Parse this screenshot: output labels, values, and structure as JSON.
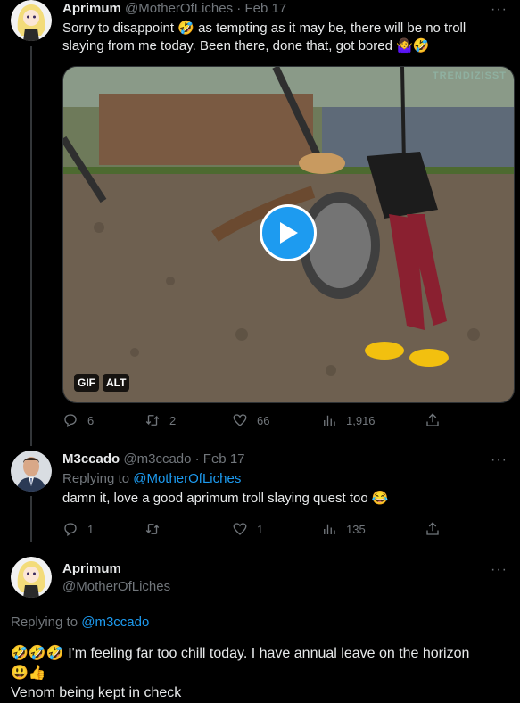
{
  "tweet1": {
    "name": "Aprimum",
    "handle": "@MotherOfLiches",
    "date": "· Feb 17",
    "text_line1": "Sorry to disappoint 🤣 as tempting as it may be, there will be no troll",
    "text_line2": "slaying from me today. Been there, done that, got bored 🤷‍♀️🤣",
    "media": {
      "watermark": "TRENDIZISST",
      "gif_badge": "GIF",
      "alt_badge": "ALT"
    },
    "replies": "6",
    "retweets": "2",
    "likes": "66",
    "views": "1,916"
  },
  "tweet2": {
    "name": "M3ccado",
    "handle": "@m3ccado",
    "date": "· Feb 17",
    "replying_prefix": "Replying to ",
    "replying_handle": "@MotherOfLiches",
    "text": "damn it, love a good aprimum troll slaying quest too 😂",
    "replies": "1",
    "retweets": "",
    "likes": "1",
    "views": "135"
  },
  "tweet3": {
    "name": "Aprimum",
    "handle": "@MotherOfLiches",
    "replying_prefix": "Replying to ",
    "replying_handle": "@m3ccado",
    "text_line1": "🤣🤣🤣 I'm feeling far too chill today. I have annual leave on the horizon",
    "text_line2": "😃👍",
    "text_line3": "Venom being kept in check"
  },
  "icons": {
    "reply": "reply-icon",
    "retweet": "retweet-icon",
    "like": "heart-icon",
    "views": "views-icon",
    "share": "share-icon",
    "more": "more-icon",
    "play": "play-icon"
  },
  "colors": {
    "accent": "#1d9bf0",
    "muted": "#71767b",
    "text": "#e7e9ea",
    "background": "#000000"
  }
}
